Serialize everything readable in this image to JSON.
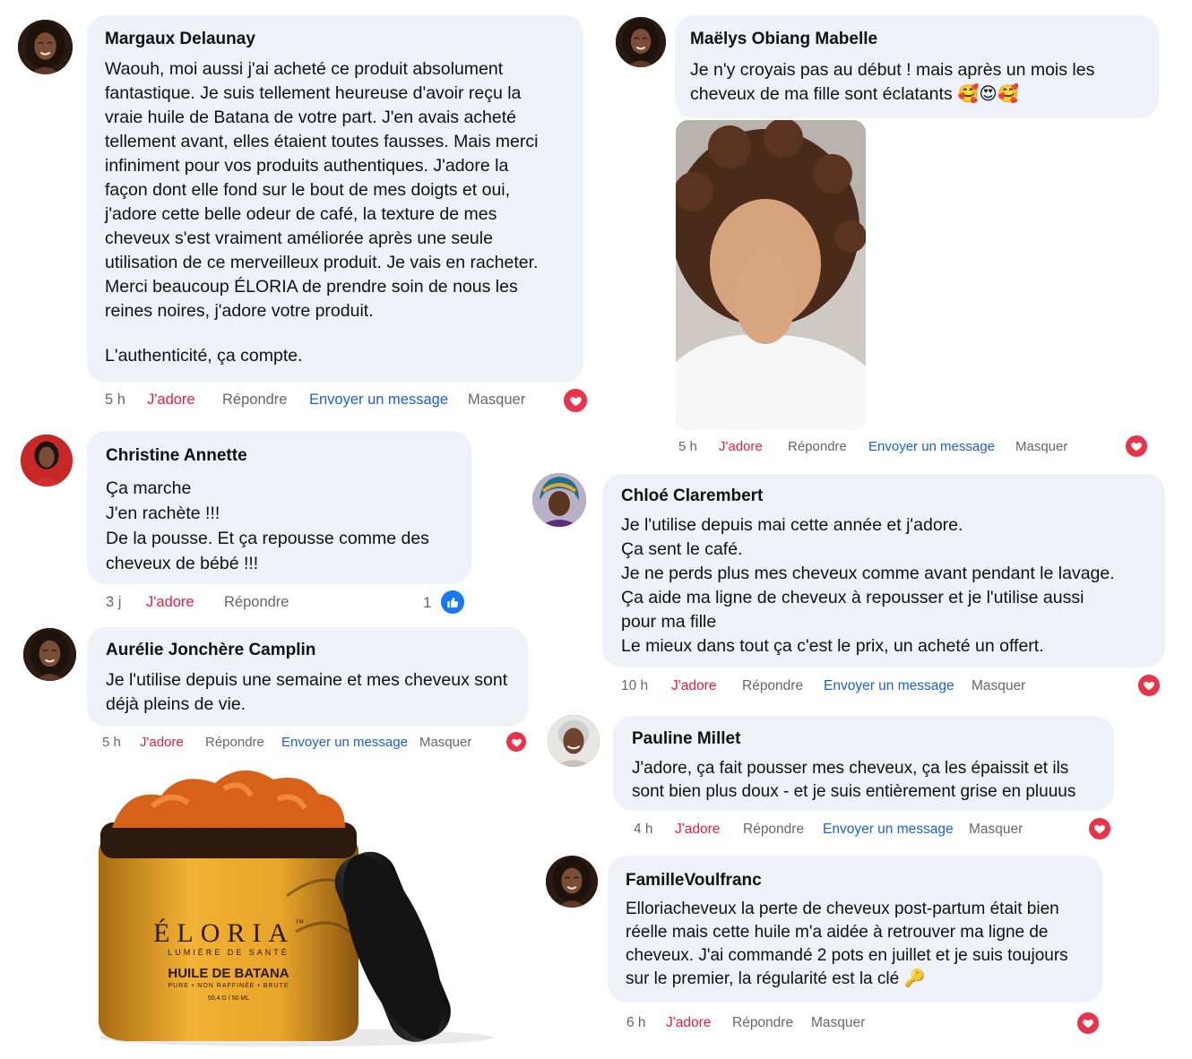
{
  "comments": [
    {
      "author": "Margaux Delaunay",
      "text": "Waouh, moi aussi j'ai acheté ce produit absolument\nfantastique. Je suis tellement heureuse d'avoir reçu la\nvraie huile de Batana de votre part. J'en avais acheté\ntellement avant, elles étaient toutes fausses. Mais merci\ninfiniment pour vos produits authentiques. J'adore la\nfaçon dont elle fond sur le bout de mes doigts et oui,\nj'adore cette belle odeur de café, la texture de mes\ncheveux s'est vraiment améliorée après une seule\nutilisation de ce merveilleux produit. Je vais en racheter.\nMerci beaucoup ÉLORIA de prendre soin de nous les\nreines noires, j'adore votre produit.",
      "text2": "L'authenticité, ça compte.",
      "time": "5 h",
      "reaction": "J'adore",
      "reply": "Répondre",
      "message": "Envoyer un message",
      "hide": "Masquer"
    },
    {
      "author": "Christine Annette",
      "text": "Ça marche\nJ'en rachète !!!\nDe la pousse. Et ça repousse comme des\ncheveux de bébé !!!",
      "time": "3 j",
      "reaction": "J'adore",
      "reply": "Répondre",
      "like_count": "1"
    },
    {
      "author": "Aurélie Jonchère Camplin",
      "text": "Je l'utilise depuis une semaine et mes cheveux sont\ndéjà pleins de vie.",
      "time": "5 h",
      "reaction": "J'adore",
      "reply": "Répondre",
      "message": "Envoyer un message",
      "hide": "Masquer"
    },
    {
      "author": "Maëlys Obiang Mabelle",
      "text": "Je n'y croyais pas au début ! mais après un mois les\ncheveux de ma fille sont éclatants 🥰😍🥰",
      "time": "5 h",
      "reaction": "J'adore",
      "reply": "Répondre",
      "message": "Envoyer un message",
      "hide": "Masquer"
    },
    {
      "author": "Chloé Clarembert",
      "text": "Je l'utilise depuis mai cette année et j'adore.\nÇa sent le café.\nJe ne perds plus mes cheveux comme avant pendant le lavage.\nÇa aide ma ligne de cheveux à repousser et je l'utilise aussi\npour ma fille\nLe mieux dans tout ça c'est le prix, un acheté un offert.",
      "time": "10 h",
      "reaction": "J'adore",
      "reply": "Répondre",
      "message": "Envoyer un message",
      "hide": "Masquer"
    },
    {
      "author": "Pauline Millet",
      "text": "J'adore, ça fait pousser mes cheveux, ça les épaissit et ils\nsont bien plus doux - et je suis entièrement grise en pluuus",
      "time": "4 h",
      "reaction": "J'adore",
      "reply": "Répondre",
      "message": "Envoyer un message",
      "hide": "Masquer"
    },
    {
      "author": "FamilleVoulfranc",
      "text": "Elloriacheveux la perte de cheveux post-partum était bien\nréelle mais cette huile m'a aidée à retrouver ma ligne de\ncheveux. J'ai commandé 2 pots en juillet et je suis toujours\nsur le premier, la régularité est la clé 🔑",
      "time": "6 h",
      "reaction": "J'adore",
      "reply": "Répondre",
      "hide": "Masquer"
    }
  ],
  "product": {
    "brand": "ÉLORIA",
    "tm": "™",
    "tagline": "LUMIÈRE DE SANTÉ",
    "name": "HUILE DE BATANA",
    "desc": "PURE • NON RAFFINÉE • BRUTE",
    "size": "50,4 G / 50 ML"
  },
  "icons": {
    "reaction": "heart-reaction-icon",
    "like": "thumbs-up-icon"
  },
  "colors": {
    "bubble": "#eef1f7",
    "love": "#e41e3f",
    "link": "#1b5fd9",
    "meta": "#65676b"
  }
}
